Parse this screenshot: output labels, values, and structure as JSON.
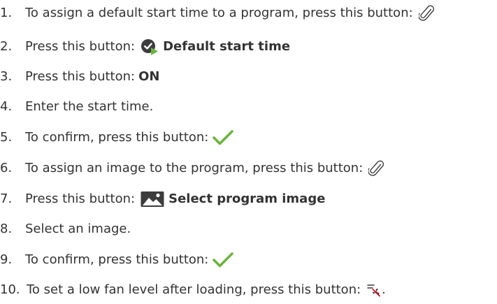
{
  "colors": {
    "text": "#333333",
    "check_green": "#6cb33f",
    "icon_dark": "#3d3d3d",
    "icon_green": "#6cb33f",
    "icon_red": "#d0021b"
  },
  "steps": [
    {
      "num": "1.",
      "text": "To assign a default start time to a program, press this button:",
      "icon": "paperclip-icon"
    },
    {
      "num": "2.",
      "text": "Press this button:",
      "icon": "default-start-time-icon",
      "button_label": "Default start time"
    },
    {
      "num": "3.",
      "text": "Press this button:",
      "button_label": "ON"
    },
    {
      "num": "4.",
      "text": "Enter the start time."
    },
    {
      "num": "5.",
      "text": "To confirm, press this button:",
      "icon": "checkmark-icon"
    },
    {
      "num": "6.",
      "text": "To assign an image to the program, press this button:",
      "icon": "paperclip-icon"
    },
    {
      "num": "7.",
      "text": "Press this button:",
      "icon": "image-icon",
      "button_label": "Select program image"
    },
    {
      "num": "8.",
      "text": "Select an image."
    },
    {
      "num": "9.",
      "text": "To confirm, press this button:",
      "icon": "checkmark-icon"
    },
    {
      "num": "10.",
      "text": "To set a low fan level after loading, press this button:",
      "icon": "low-fan-icon",
      "suffix": "."
    }
  ]
}
